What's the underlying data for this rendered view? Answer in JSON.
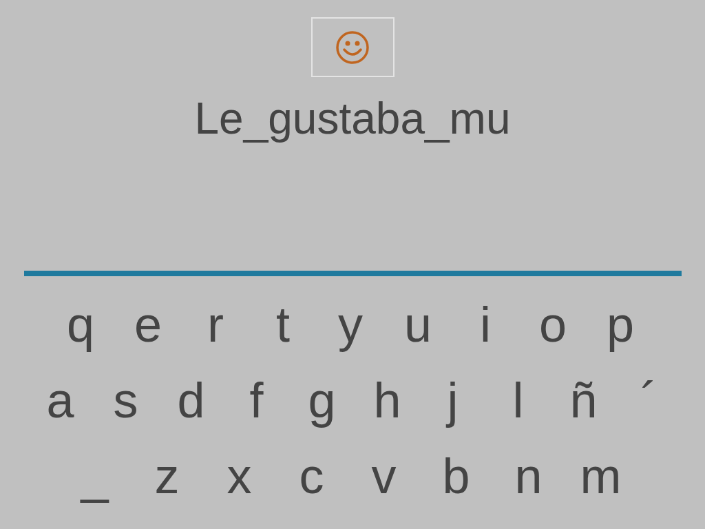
{
  "word": "Le_gustaba_mu",
  "keyboard": {
    "rows": [
      [
        "q",
        "e",
        "r",
        "t",
        "y",
        "u",
        "i",
        "o",
        "p"
      ],
      [
        "a",
        "s",
        "d",
        "f",
        "g",
        "h",
        "j",
        "l",
        "ñ",
        "´"
      ],
      [
        "_",
        "z",
        "x",
        "c",
        "v",
        "b",
        "n",
        "m"
      ]
    ]
  }
}
